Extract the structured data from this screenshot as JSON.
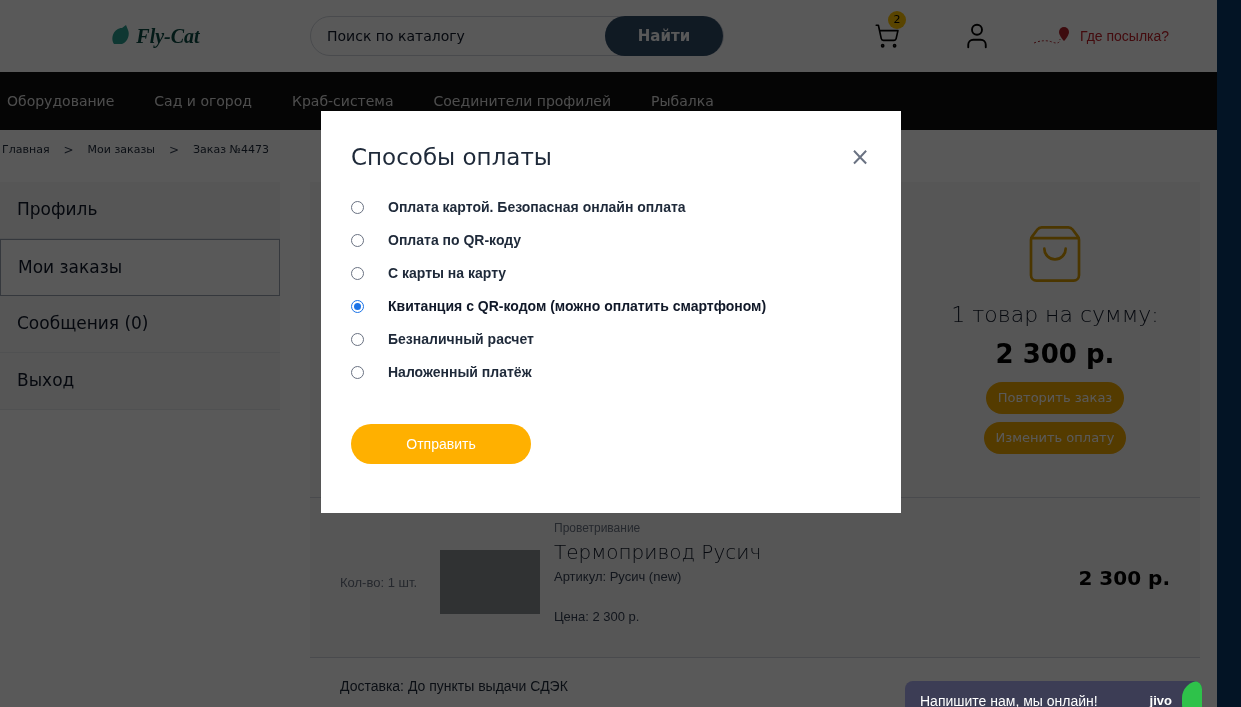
{
  "header": {
    "logo": "Fly-Cat",
    "search": {
      "placeholder": "Поиск по каталогу",
      "button": "Найти"
    },
    "cart_count": "2",
    "tracking": "Где посылка?"
  },
  "nav": [
    "Оборудование",
    "Сад и огород",
    "Краб-система",
    "Соединители профилей",
    "Рыбалка"
  ],
  "breadcrumbs": [
    "Главная",
    "Мои заказы",
    "Заказ №4473"
  ],
  "breadcrumb_separator": ">",
  "sidebar": [
    {
      "label": "Профиль",
      "selected": false
    },
    {
      "label": "Мои заказы",
      "selected": true
    },
    {
      "label": "Сообщения (0)",
      "selected": false
    },
    {
      "label": "Выход",
      "selected": false
    }
  ],
  "summary": {
    "count_text": "1 товар на сумму:",
    "total": "2 300 р.",
    "buttons": [
      "Повторить заказ",
      "Изменить оплату"
    ]
  },
  "item": {
    "quantity": "Кол-во: 1 шт.",
    "category": "Проветривание",
    "name": "Термопривод Русич",
    "sku": "Артикул: Русич (new)",
    "price": "Цена: 2 300 р.",
    "sum": "2 300 р."
  },
  "delivery": "Доставка: До пункты выдачи СДЭК",
  "chat": {
    "text": "Напишите нам, мы онлайн!",
    "brand": "jivo"
  },
  "modal": {
    "title": "Способы оплаты",
    "close": "×",
    "options": [
      {
        "label": "Оплата картой. Безопасная онлайн оплата",
        "selected": false
      },
      {
        "label": "Оплата по QR-коду",
        "selected": false
      },
      {
        "label": "С карты на карту",
        "selected": false
      },
      {
        "label": "Квитанция с QR-кодом (можно оплатить смартфоном)",
        "selected": true
      },
      {
        "label": "Безналичный расчет",
        "selected": false
      },
      {
        "label": "Наложенный платёж",
        "selected": false
      }
    ],
    "submit": "Отправить"
  }
}
